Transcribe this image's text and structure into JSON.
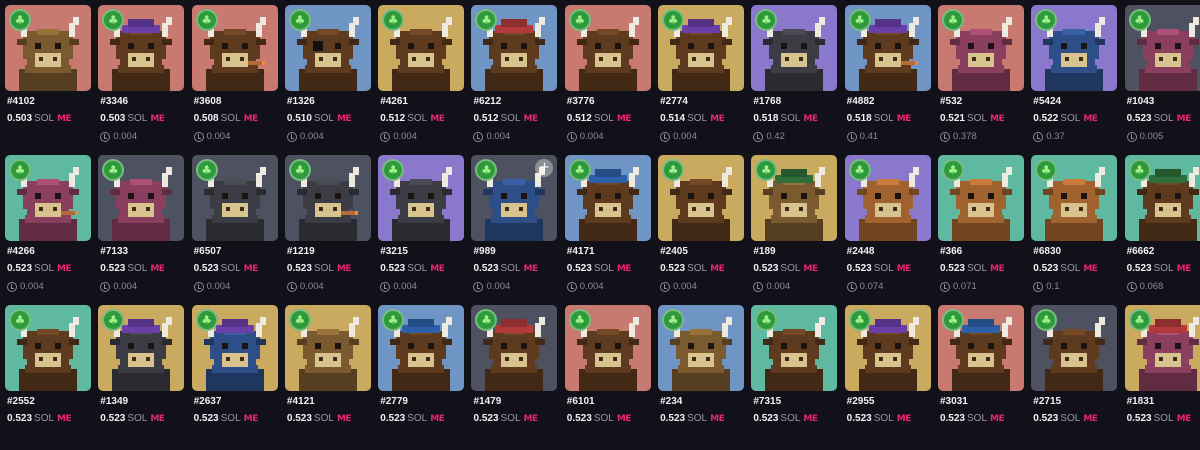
{
  "icons": {
    "badge": "clover-icon",
    "last_sale": "history-icon",
    "add": "plus-icon",
    "marketplace": "magic-eden-logo"
  },
  "currency": "SOL",
  "marketplace_mark": "ME",
  "items": [
    {
      "id": "#4102",
      "price": "0.503",
      "last": "",
      "bg": "#c87a70",
      "body": "#7a5a2e",
      "hat": "",
      "extra": ""
    },
    {
      "id": "#3346",
      "price": "0.503",
      "last": "0.004",
      "bg": "#c87a70",
      "body": "#5e3a1e",
      "hat": "#6b3fa8",
      "extra": ""
    },
    {
      "id": "#3608",
      "price": "0.508",
      "last": "0.004",
      "bg": "#c87a70",
      "body": "#5e3a1e",
      "hat": "",
      "extra": "cigar"
    },
    {
      "id": "#1326",
      "price": "0.510",
      "last": "0.004",
      "bg": "#6f95c4",
      "body": "#5e3a1e",
      "hat": "",
      "extra": "patch"
    },
    {
      "id": "#4261",
      "price": "0.512",
      "last": "0.004",
      "bg": "#c9aa5f",
      "body": "#5e3a1e",
      "hat": "",
      "extra": ""
    },
    {
      "id": "#6212",
      "price": "0.512",
      "last": "0.004",
      "bg": "#6f95c4",
      "body": "#5e3a1e",
      "hat": "#b23a3a",
      "extra": ""
    },
    {
      "id": "#3776",
      "price": "0.512",
      "last": "0.004",
      "bg": "#c87a70",
      "body": "#5e3a1e",
      "hat": "",
      "extra": ""
    },
    {
      "id": "#2774",
      "price": "0.514",
      "last": "0.004",
      "bg": "#c9aa5f",
      "body": "#5e3a1e",
      "hat": "#6b3fa8",
      "extra": ""
    },
    {
      "id": "#1768",
      "price": "0.518",
      "last": "0.42",
      "bg": "#8a78cc",
      "body": "#3c3c44",
      "hat": "",
      "extra": ""
    },
    {
      "id": "#4882",
      "price": "0.518",
      "last": "0.41",
      "bg": "#6f95c4",
      "body": "#5e3a1e",
      "hat": "#6b3fa8",
      "extra": "cigar"
    },
    {
      "id": "#532",
      "price": "0.521",
      "last": "0.378",
      "bg": "#c87a70",
      "body": "#8a3f5e",
      "hat": "",
      "extra": ""
    },
    {
      "id": "#5424",
      "price": "0.522",
      "last": "0.37",
      "bg": "#8a78cc",
      "body": "#2d4e86",
      "hat": "",
      "extra": ""
    },
    {
      "id": "#1043",
      "price": "0.523",
      "last": "0.005",
      "bg": "#4e5260",
      "body": "#8a3f5e",
      "hat": "",
      "extra": ""
    },
    {
      "id": "#4266",
      "price": "0.523",
      "last": "0.004",
      "bg": "#5fb8a0",
      "body": "#8a3f5e",
      "hat": "",
      "extra": "cigar"
    },
    {
      "id": "#7133",
      "price": "0.523",
      "last": "0.004",
      "bg": "#4e5260",
      "body": "#8a3f5e",
      "hat": "",
      "extra": ""
    },
    {
      "id": "#6507",
      "price": "0.523",
      "last": "0.004",
      "bg": "#4e5260",
      "body": "#3c3c44",
      "hat": "",
      "extra": ""
    },
    {
      "id": "#1219",
      "price": "0.523",
      "last": "0.004",
      "bg": "#4e5260",
      "body": "#3c3c44",
      "hat": "",
      "extra": "cigar"
    },
    {
      "id": "#3215",
      "price": "0.523",
      "last": "0.004",
      "bg": "#8a78cc",
      "body": "#3c3c44",
      "hat": "",
      "extra": ""
    },
    {
      "id": "#989",
      "price": "0.523",
      "last": "0.004",
      "bg": "#4e5260",
      "body": "#2d4e86",
      "hat": "",
      "extra": "",
      "plus": true
    },
    {
      "id": "#4171",
      "price": "0.523",
      "last": "0.004",
      "bg": "#6f95c4",
      "body": "#5e3a1e",
      "hat": "#2d5fa8",
      "extra": ""
    },
    {
      "id": "#2405",
      "price": "0.523",
      "last": "0.004",
      "bg": "#c9aa5f",
      "body": "#5e3a1e",
      "hat": "",
      "extra": ""
    },
    {
      "id": "#189",
      "price": "0.523",
      "last": "0.004",
      "bg": "#c9aa5f",
      "body": "#7a5a2e",
      "hat": "#2f6e3a",
      "extra": ""
    },
    {
      "id": "#2448",
      "price": "0.523",
      "last": "0.074",
      "bg": "#8a78cc",
      "body": "#a0622e",
      "hat": "",
      "extra": ""
    },
    {
      "id": "#366",
      "price": "0.523",
      "last": "0.071",
      "bg": "#5fb8a0",
      "body": "#a0622e",
      "hat": "",
      "extra": ""
    },
    {
      "id": "#6830",
      "price": "0.523",
      "last": "0.1",
      "bg": "#5fb8a0",
      "body": "#a0622e",
      "hat": "",
      "extra": ""
    },
    {
      "id": "#6662",
      "price": "0.523",
      "last": "0.068",
      "bg": "#5fb8a0",
      "body": "#5e3a1e",
      "hat": "#2f6e3a",
      "extra": ""
    },
    {
      "id": "#2552",
      "price": "0.523",
      "last": "",
      "bg": "#5fb8a0",
      "body": "#5e3a1e",
      "hat": "",
      "extra": ""
    },
    {
      "id": "#1349",
      "price": "0.523",
      "last": "",
      "bg": "#c9aa5f",
      "body": "#3c3c44",
      "hat": "#6b3fa8",
      "extra": ""
    },
    {
      "id": "#2637",
      "price": "0.523",
      "last": "",
      "bg": "#c9aa5f",
      "body": "#2d4e86",
      "hat": "#6b3fa8",
      "extra": ""
    },
    {
      "id": "#4121",
      "price": "0.523",
      "last": "",
      "bg": "#c9aa5f",
      "body": "#7a5a2e",
      "hat": "",
      "extra": ""
    },
    {
      "id": "#2779",
      "price": "0.523",
      "last": "",
      "bg": "#6f95c4",
      "body": "#5e3a1e",
      "hat": "#2d5fa8",
      "extra": ""
    },
    {
      "id": "#1479",
      "price": "0.523",
      "last": "",
      "bg": "#4e5260",
      "body": "#5e3a1e",
      "hat": "#b23a3a",
      "extra": ""
    },
    {
      "id": "#6101",
      "price": "0.523",
      "last": "",
      "bg": "#c87a70",
      "body": "#5e3a1e",
      "hat": "",
      "extra": ""
    },
    {
      "id": "#234",
      "price": "0.523",
      "last": "",
      "bg": "#6f95c4",
      "body": "#7a5a2e",
      "hat": "",
      "extra": ""
    },
    {
      "id": "#7315",
      "price": "0.523",
      "last": "",
      "bg": "#5fb8a0",
      "body": "#5e3a1e",
      "hat": "",
      "extra": ""
    },
    {
      "id": "#2955",
      "price": "0.523",
      "last": "",
      "bg": "#c9aa5f",
      "body": "#5e3a1e",
      "hat": "#6b3fa8",
      "extra": ""
    },
    {
      "id": "#3031",
      "price": "0.523",
      "last": "",
      "bg": "#c87a70",
      "body": "#5e3a1e",
      "hat": "#2d5fa8",
      "extra": ""
    },
    {
      "id": "#2715",
      "price": "0.523",
      "last": "",
      "bg": "#4e5260",
      "body": "#5e3a1e",
      "hat": "",
      "extra": ""
    },
    {
      "id": "#1831",
      "price": "0.523",
      "last": "",
      "bg": "#c9aa5f",
      "body": "#8a3f5e",
      "hat": "#b23a3a",
      "extra": ""
    }
  ]
}
